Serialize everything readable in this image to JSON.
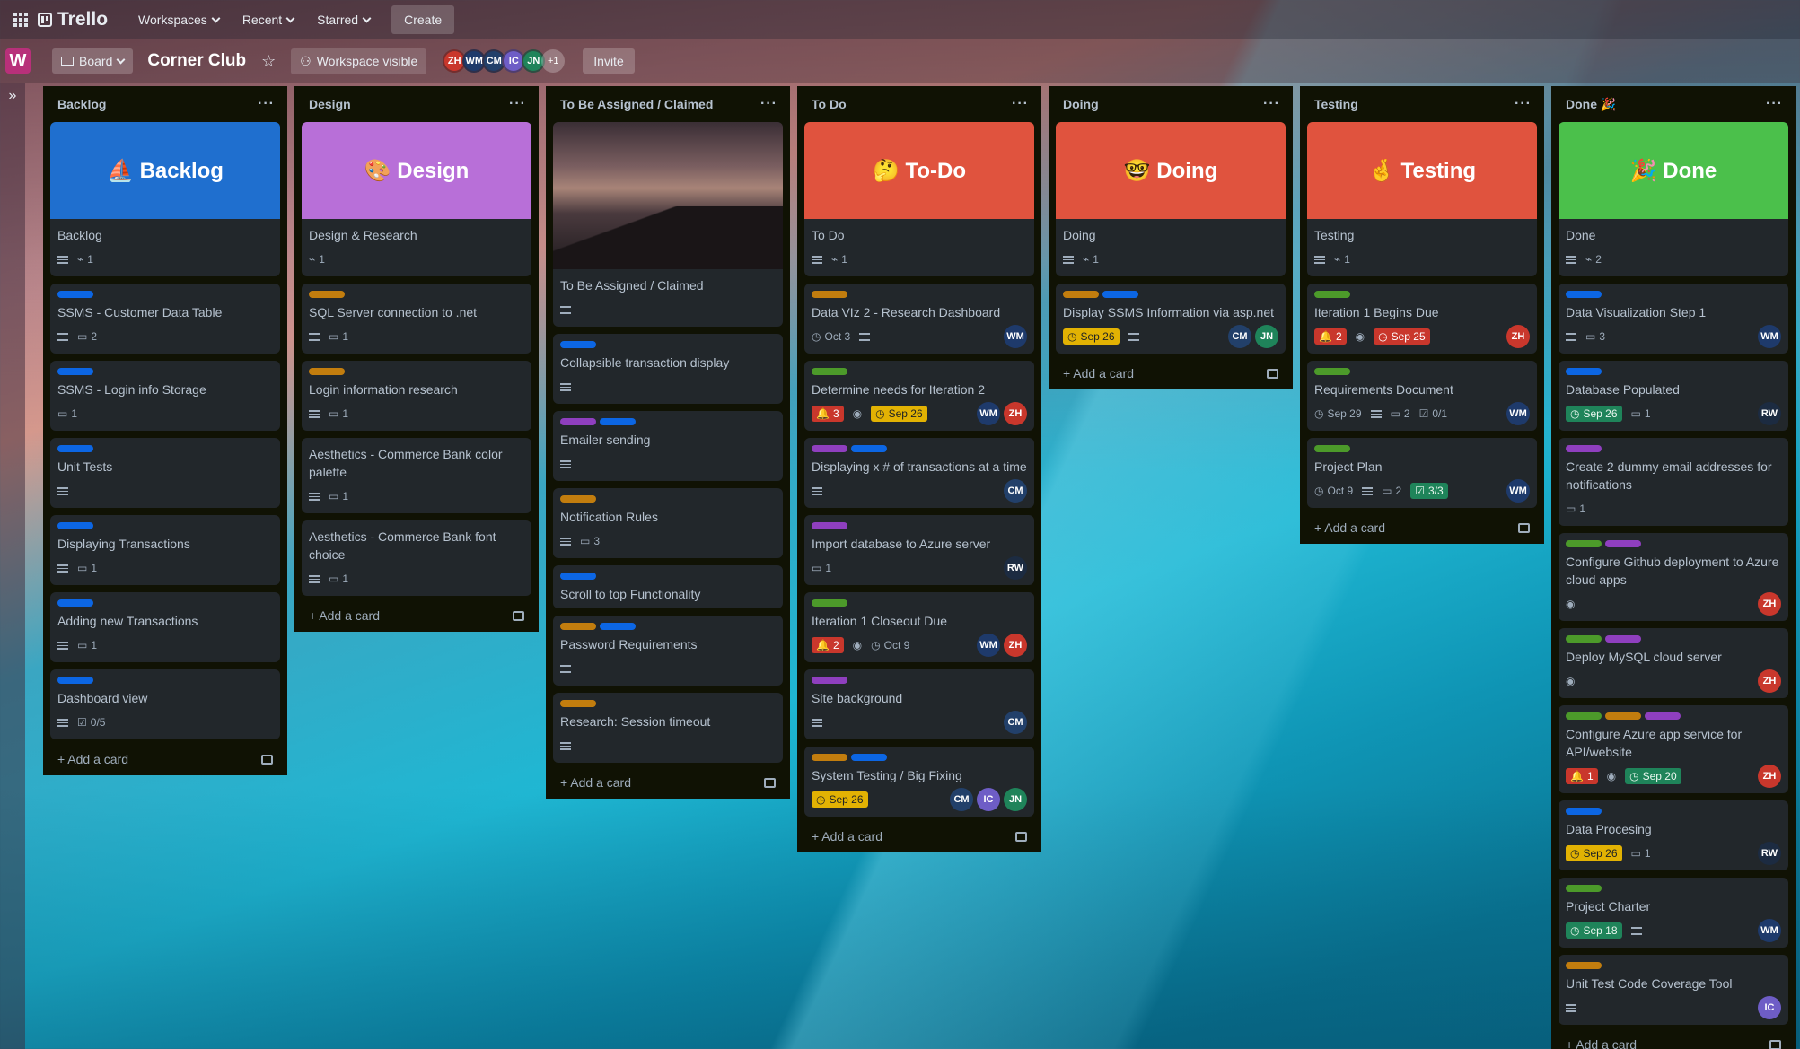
{
  "topbar": {
    "app_name": "Trello",
    "nav": [
      "Workspaces",
      "Recent",
      "Starred"
    ],
    "create_label": "Create"
  },
  "boardbar": {
    "workspace_initial": "W",
    "view_label": "Board",
    "board_title": "Corner Club",
    "visibility_label": "Workspace visible",
    "members": [
      "ZH",
      "WM",
      "CM",
      "IC",
      "JN"
    ],
    "members_more": "+1",
    "invite_label": "Invite"
  },
  "sidebar": {
    "expand_icon": "»"
  },
  "colors": {
    "accent": "#0c66e4",
    "list_bg": "#101204",
    "card_bg": "#22272b"
  },
  "add_card_label": "Add a card",
  "lists": [
    {
      "title": "Backlog",
      "cards": [
        {
          "cover": {
            "color": "#1f6fcf",
            "text": "⛵ Backlog"
          },
          "title": "Backlog",
          "badges": {
            "desc": true,
            "attach": "1"
          }
        },
        {
          "labels": [
            "blue"
          ],
          "title": "SSMS - Customer Data Table",
          "badges": {
            "desc": true,
            "comments": "2"
          }
        },
        {
          "labels": [
            "blue"
          ],
          "title": "SSMS - Login info Storage",
          "badges": {
            "comments": "1"
          }
        },
        {
          "labels": [
            "blue"
          ],
          "title": "Unit Tests",
          "badges": {
            "desc": true
          }
        },
        {
          "labels": [
            "blue"
          ],
          "title": "Displaying Transactions",
          "badges": {
            "desc": true,
            "comments": "1"
          }
        },
        {
          "labels": [
            "blue"
          ],
          "title": "Adding new Transactions",
          "badges": {
            "desc": true,
            "comments": "1"
          }
        },
        {
          "labels": [
            "blue"
          ],
          "title": "Dashboard view",
          "badges": {
            "desc": true,
            "checklist": "0/5"
          }
        }
      ]
    },
    {
      "title": "Design",
      "cards": [
        {
          "cover": {
            "color": "#b86fd8",
            "text": "🎨 Design"
          },
          "title": "Design & Research",
          "badges": {
            "attach": "1"
          }
        },
        {
          "labels": [
            "orange"
          ],
          "title": "SQL Server connection to .net",
          "badges": {
            "desc": true,
            "comments": "1"
          }
        },
        {
          "labels": [
            "orange"
          ],
          "title": "Login information research",
          "badges": {
            "desc": true,
            "comments": "1"
          }
        },
        {
          "title": "Aesthetics - Commerce Bank color palette",
          "badges": {
            "desc": true,
            "comments": "1"
          }
        },
        {
          "title": "Aesthetics - Commerce Bank font choice",
          "badges": {
            "desc": true,
            "comments": "1"
          }
        }
      ]
    },
    {
      "title": "To Be Assigned / Claimed",
      "cards": [
        {
          "cover": {
            "photo": true
          },
          "title": "To Be Assigned / Claimed",
          "badges": {
            "desc": true
          }
        },
        {
          "labels": [
            "blue"
          ],
          "title": "Collapsible transaction display",
          "badges": {
            "desc": true
          }
        },
        {
          "labels": [
            "purple",
            "blue"
          ],
          "title": "Emailer sending",
          "badges": {
            "desc": true
          }
        },
        {
          "labels": [
            "orange"
          ],
          "title": "Notification Rules",
          "badges": {
            "desc": true,
            "comments": "3"
          }
        },
        {
          "labels": [
            "blue"
          ],
          "title": "Scroll to top Functionality",
          "badges": {}
        },
        {
          "labels": [
            "orange",
            "blue"
          ],
          "title": "Password Requirements",
          "badges": {
            "desc": true
          }
        },
        {
          "labels": [
            "orange"
          ],
          "title": "Research: Session timeout",
          "badges": {
            "desc": true
          }
        }
      ]
    },
    {
      "title": "To Do",
      "cards": [
        {
          "cover": {
            "color": "#e0533e",
            "text": "🤔 To-Do"
          },
          "title": "To Do",
          "badges": {
            "desc": true,
            "attach": "1"
          }
        },
        {
          "labels": [
            "orange"
          ],
          "title": "Data VIz 2 - Research Dashboard",
          "badges": {
            "date": "Oct 3",
            "desc": true
          },
          "members": [
            "WM"
          ]
        },
        {
          "labels": [
            "green"
          ],
          "title": "Determine needs for Iteration 2",
          "badges": {
            "notify": "3",
            "watch": true,
            "due": {
              "text": "Sep 26",
              "style": "yellow"
            }
          },
          "members": [
            "WM",
            "ZH"
          ]
        },
        {
          "labels": [
            "purple",
            "blue"
          ],
          "title": "Displaying x # of transactions at a time",
          "badges": {
            "desc": true
          },
          "members": [
            "CM"
          ]
        },
        {
          "labels": [
            "purple"
          ],
          "title": "Import database to Azure server",
          "badges": {
            "comments": "1"
          },
          "members": [
            "RW"
          ]
        },
        {
          "labels": [
            "green"
          ],
          "title": "Iteration 1 Closeout Due",
          "badges": {
            "notify": "2",
            "watch": true,
            "date": "Oct 9"
          },
          "members": [
            "WM",
            "ZH"
          ]
        },
        {
          "labels": [
            "purple"
          ],
          "title": "Site background",
          "badges": {
            "desc": true
          },
          "members": [
            "CM"
          ]
        },
        {
          "labels": [
            "orange",
            "blue"
          ],
          "title": "System Testing / Big Fixing",
          "badges": {
            "due": {
              "text": "Sep 26",
              "style": "yellow"
            }
          },
          "members": [
            "CM",
            "IC",
            "JN"
          ]
        }
      ]
    },
    {
      "title": "Doing",
      "cards": [
        {
          "cover": {
            "color": "#e0533e",
            "text": "🤓 Doing"
          },
          "title": "Doing",
          "badges": {
            "desc": true,
            "attach": "1"
          }
        },
        {
          "labels": [
            "orange",
            "blue"
          ],
          "title": "Display SSMS Information via asp.net",
          "badges": {
            "due": {
              "text": "Sep 26",
              "style": "yellow"
            },
            "desc": true
          },
          "members": [
            "CM",
            "JN"
          ]
        }
      ]
    },
    {
      "title": "Testing",
      "cards": [
        {
          "cover": {
            "color": "#e0533e",
            "text": "🤞 Testing"
          },
          "title": "Testing",
          "badges": {
            "desc": true,
            "attach": "1"
          }
        },
        {
          "labels": [
            "green"
          ],
          "title": "Iteration 1 Begins Due",
          "badges": {
            "notify": "2",
            "watch": true,
            "due": {
              "text": "Sep 25",
              "style": "red"
            }
          },
          "members": [
            "ZH"
          ]
        },
        {
          "labels": [
            "green"
          ],
          "title": "Requirements Document",
          "badges": {
            "date": "Sep 29",
            "desc": true,
            "comments": "2",
            "checklist": "0/1"
          },
          "members": [
            "WM"
          ]
        },
        {
          "labels": [
            "green"
          ],
          "title": "Project Plan",
          "badges": {
            "date": "Oct 9",
            "desc": true,
            "comments": "2",
            "checkchip": "3/3"
          },
          "members": [
            "WM"
          ]
        }
      ]
    },
    {
      "title": "Done 🎉",
      "cards": [
        {
          "cover": {
            "color": "#4bc04b",
            "text": "🎉 Done"
          },
          "title": "Done",
          "badges": {
            "desc": true,
            "attach": "2"
          }
        },
        {
          "labels": [
            "blue"
          ],
          "title": "Data Visualization Step 1",
          "badges": {
            "desc": true,
            "comments": "3"
          },
          "members": [
            "WM"
          ]
        },
        {
          "labels": [
            "blue"
          ],
          "title": "Database Populated",
          "badges": {
            "due": {
              "text": "Sep 26",
              "style": "green"
            },
            "comments": "1"
          },
          "members": [
            "RW"
          ]
        },
        {
          "labels": [
            "purple"
          ],
          "title": "Create 2 dummy email addresses for notifications",
          "badges": {
            "comments": "1"
          }
        },
        {
          "labels": [
            "green",
            "purple"
          ],
          "title": "Configure Github deployment to Azure cloud apps",
          "badges": {
            "watch": true
          },
          "members": [
            "ZH"
          ]
        },
        {
          "labels": [
            "green",
            "purple"
          ],
          "title": "Deploy MySQL cloud server",
          "badges": {
            "watch": true
          },
          "members": [
            "ZH"
          ]
        },
        {
          "labels": [
            "green",
            "orange",
            "purple"
          ],
          "title": "Configure Azure app service for API/website",
          "badges": {
            "notify": "1",
            "watch": true,
            "due": {
              "text": "Sep 20",
              "style": "green"
            }
          },
          "members": [
            "ZH"
          ]
        },
        {
          "labels": [
            "blue"
          ],
          "title": "Data Procesing",
          "badges": {
            "due": {
              "text": "Sep 26",
              "style": "yellow"
            },
            "comments": "1"
          },
          "members": [
            "RW"
          ]
        },
        {
          "labels": [
            "green"
          ],
          "title": "Project Charter",
          "badges": {
            "due": {
              "text": "Sep 18",
              "style": "green"
            },
            "desc": true
          },
          "members": [
            "WM"
          ]
        },
        {
          "labels": [
            "orange"
          ],
          "title": "Unit Test Code Coverage Tool",
          "badges": {
            "desc": true
          },
          "members": [
            "IC"
          ]
        }
      ]
    }
  ]
}
